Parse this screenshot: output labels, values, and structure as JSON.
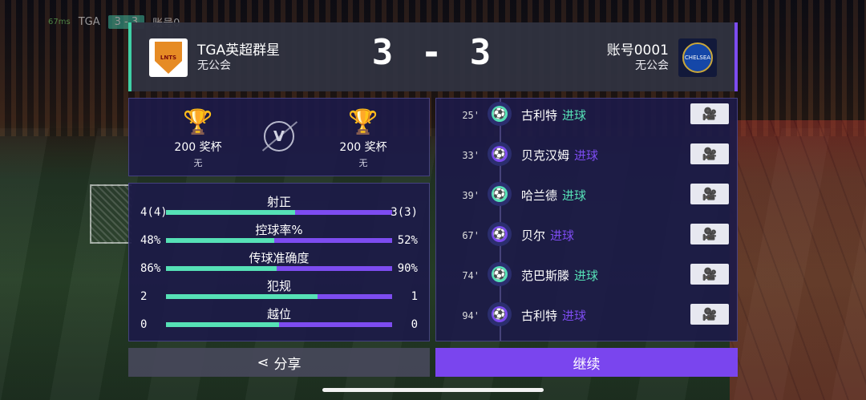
{
  "status": {
    "ping": "67ms",
    "team_short": "TGA",
    "score_mini": "3 - 3",
    "account_short": "账号0"
  },
  "header": {
    "home": {
      "name": "TGA英超群星",
      "guild": "无公会",
      "crest_text": "LNTS"
    },
    "away": {
      "name": "账号0001",
      "guild": "无公会",
      "crest_text": "CHELSEA"
    },
    "score": "3 - 3"
  },
  "trophies": {
    "home": {
      "count": "200 奖杯",
      "sub": "无"
    },
    "away": {
      "count": "200 奖杯",
      "sub": "无"
    },
    "vs": "V"
  },
  "stats": [
    {
      "label": "射正",
      "left": "4(4)",
      "right": "3(3)",
      "home_share": 0.57
    },
    {
      "label": "控球率%",
      "left": "48%",
      "right": "52%",
      "home_share": 0.48
    },
    {
      "label": "传球准确度",
      "left": "86%",
      "right": "90%",
      "home_share": 0.49
    },
    {
      "label": "犯规",
      "left": "2",
      "right": "1",
      "home_share": 0.67
    },
    {
      "label": "越位",
      "left": "0",
      "right": "0",
      "home_share": 0.5
    }
  ],
  "events": [
    {
      "minute": "25'",
      "player": "古利特",
      "event": "进球",
      "side": "home"
    },
    {
      "minute": "33'",
      "player": "贝克汉姆",
      "event": "进球",
      "side": "away"
    },
    {
      "minute": "39'",
      "player": "哈兰德",
      "event": "进球",
      "side": "home"
    },
    {
      "minute": "67'",
      "player": "贝尔",
      "event": "进球",
      "side": "away"
    },
    {
      "minute": "74'",
      "player": "范巴斯滕",
      "event": "进球",
      "side": "home"
    },
    {
      "minute": "94'",
      "player": "古利特",
      "event": "进球",
      "side": "away"
    }
  ],
  "buttons": {
    "share": "分享",
    "continue": "继续"
  },
  "colors": {
    "home": "#56e1b6",
    "away": "#7d4cf0",
    "continue_bg": "#7a45ee"
  }
}
